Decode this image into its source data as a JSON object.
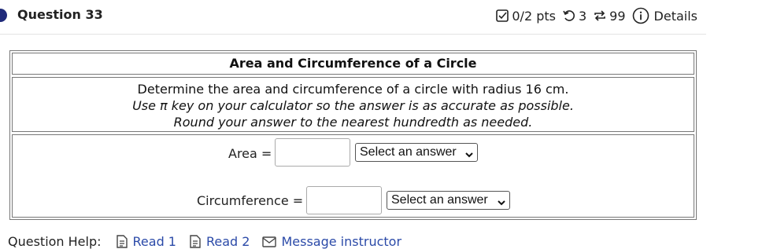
{
  "question": {
    "title": "Question 33"
  },
  "meta": {
    "score": "0/2 pts",
    "retries": "3",
    "attempts": "99",
    "details_label": "Details"
  },
  "problem": {
    "heading": "Area and Circumference of a Circle",
    "line1": "Determine the area and circumference of a circle with radius 16 cm.",
    "line2": "Use π key on your calculator so the answer is as accurate as possible.",
    "line3": "Round your answer to the nearest hundredth as needed."
  },
  "answers": {
    "area_label": "Area =",
    "area_value": "",
    "area_unit_select": "Select an answer",
    "circ_label": "Circumference =",
    "circ_value": "",
    "circ_unit_select": "Select an answer"
  },
  "help": {
    "label": "Question Help:",
    "links": [
      "Read 1",
      "Read 2",
      "Message instructor"
    ]
  },
  "colors": {
    "accent_dot": "#1f2a7a",
    "link": "#2b4aa8"
  }
}
